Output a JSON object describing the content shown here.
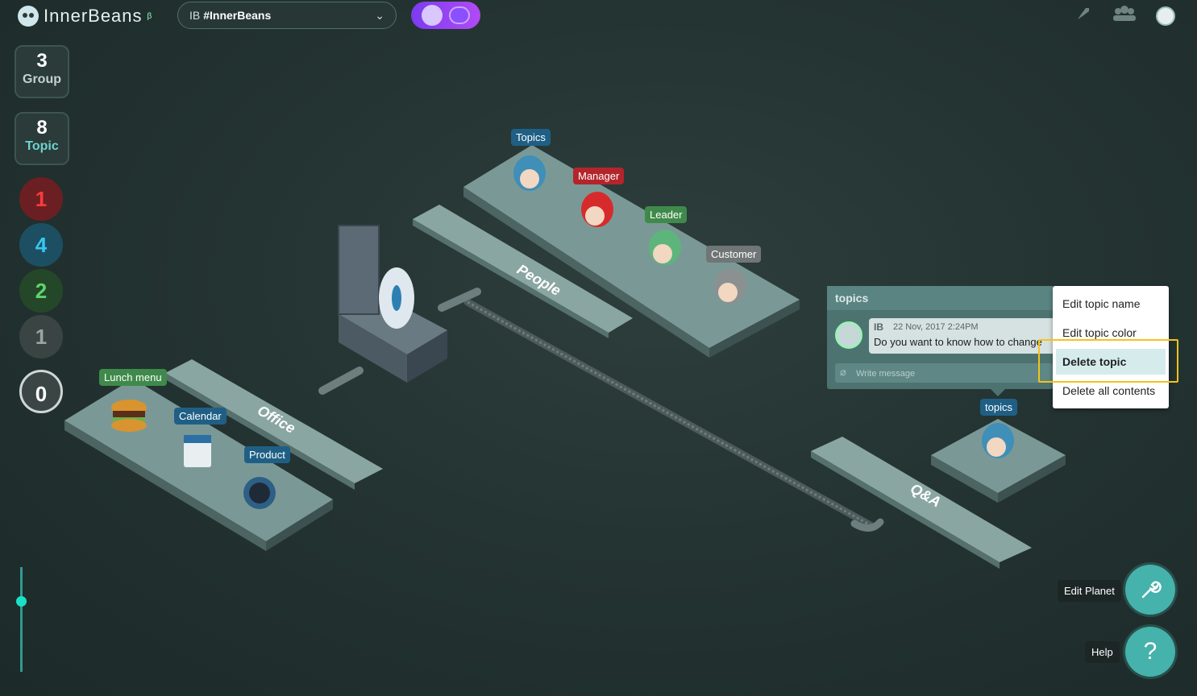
{
  "app": {
    "name": "InnerBeans",
    "beta_mark": "β",
    "planet_prefix": "IB",
    "planet_name": "#InnerBeans"
  },
  "sidebar": {
    "group": {
      "count": "3",
      "label": "Group"
    },
    "topic": {
      "count": "8",
      "label": "Topic"
    },
    "badges": [
      {
        "value": "1",
        "color": "#c8232c"
      },
      {
        "value": "4",
        "color": "#2d8fb5"
      },
      {
        "value": "2",
        "color": "#3f9b48"
      },
      {
        "value": "1",
        "color": "#6c7472"
      },
      {
        "value": "0",
        "color": "#e6ecea"
      }
    ],
    "zoom_level": 0.28
  },
  "scene": {
    "zones": [
      "People",
      "Office",
      "Q&A"
    ],
    "topic_tags": [
      {
        "label": "Topics",
        "color": "#1f5f85"
      },
      {
        "label": "Manager",
        "color": "#b3252b"
      },
      {
        "label": "Leader",
        "color": "#3f8a4b"
      },
      {
        "label": "Customer",
        "color": "#6f7675"
      },
      {
        "label": "Lunch menu",
        "color": "#3f8a4b"
      },
      {
        "label": "Calendar",
        "color": "#1f5f85"
      },
      {
        "label": "Product",
        "color": "#1f5f85"
      },
      {
        "label": "topics",
        "color": "#1f5f85"
      }
    ]
  },
  "topic_panel": {
    "title": "topics",
    "message": {
      "author": "IB",
      "time": "22 Nov, 2017 2:24PM",
      "text": "Do you want to know how to change"
    },
    "input_placeholder": "Write message"
  },
  "context_menu": {
    "items": [
      "Edit topic name",
      "Edit topic color",
      "Delete topic",
      "Delete all contents"
    ],
    "selected": "Delete topic"
  },
  "bottom_actions": {
    "edit_planet": "Edit Planet",
    "help": "Help"
  }
}
